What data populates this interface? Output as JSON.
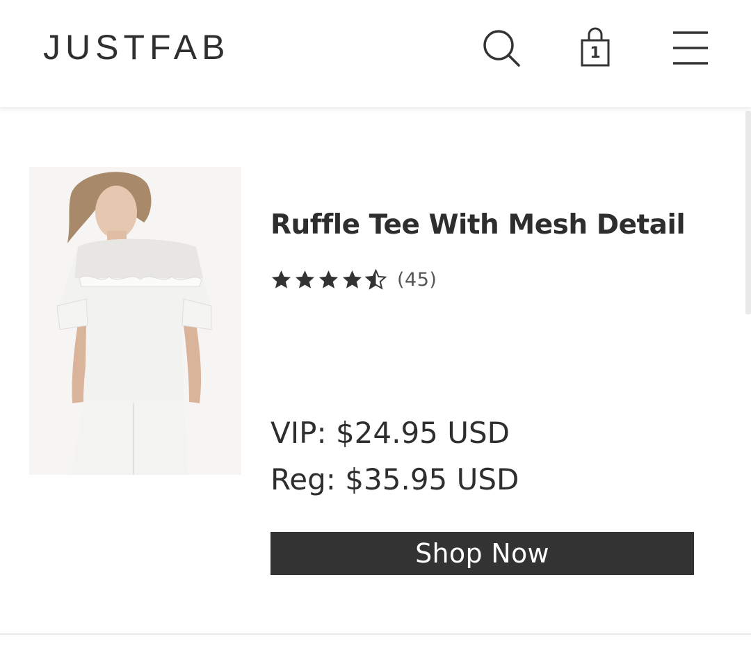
{
  "header": {
    "logo": "JUSTFAB",
    "search_icon": "search-icon",
    "bag_icon": "shopping-bag-icon",
    "bag_count": "1",
    "menu_icon": "hamburger-menu-icon"
  },
  "product": {
    "title": "Ruffle Tee With Mesh Detail",
    "rating": 4.5,
    "rating_max": 5,
    "review_count": "(45)",
    "vip_price": "VIP: $24.95 USD",
    "reg_price": "Reg: $35.95 USD",
    "cta_label": "Shop Now",
    "image_icon": "product-photo-white-ruffle-tee"
  },
  "colors": {
    "brand_dark": "#333333",
    "text": "#2e2e2e",
    "background": "#ffffff"
  }
}
